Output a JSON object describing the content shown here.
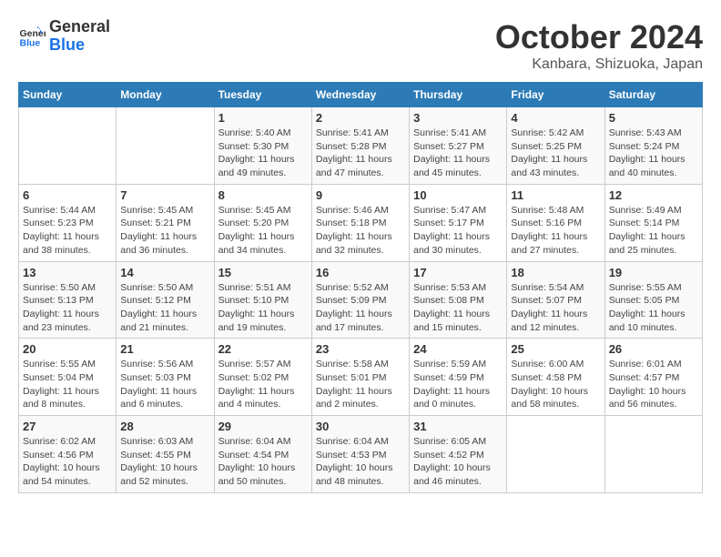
{
  "header": {
    "logo": {
      "line1": "General",
      "line2": "Blue"
    },
    "title": "October 2024",
    "location": "Kanbara, Shizuoka, Japan"
  },
  "days_of_week": [
    "Sunday",
    "Monday",
    "Tuesday",
    "Wednesday",
    "Thursday",
    "Friday",
    "Saturday"
  ],
  "weeks": [
    [
      {
        "day": null,
        "data": null
      },
      {
        "day": null,
        "data": null
      },
      {
        "day": "1",
        "data": "Sunrise: 5:40 AM\nSunset: 5:30 PM\nDaylight: 11 hours and 49 minutes."
      },
      {
        "day": "2",
        "data": "Sunrise: 5:41 AM\nSunset: 5:28 PM\nDaylight: 11 hours and 47 minutes."
      },
      {
        "day": "3",
        "data": "Sunrise: 5:41 AM\nSunset: 5:27 PM\nDaylight: 11 hours and 45 minutes."
      },
      {
        "day": "4",
        "data": "Sunrise: 5:42 AM\nSunset: 5:25 PM\nDaylight: 11 hours and 43 minutes."
      },
      {
        "day": "5",
        "data": "Sunrise: 5:43 AM\nSunset: 5:24 PM\nDaylight: 11 hours and 40 minutes."
      }
    ],
    [
      {
        "day": "6",
        "data": "Sunrise: 5:44 AM\nSunset: 5:23 PM\nDaylight: 11 hours and 38 minutes."
      },
      {
        "day": "7",
        "data": "Sunrise: 5:45 AM\nSunset: 5:21 PM\nDaylight: 11 hours and 36 minutes."
      },
      {
        "day": "8",
        "data": "Sunrise: 5:45 AM\nSunset: 5:20 PM\nDaylight: 11 hours and 34 minutes."
      },
      {
        "day": "9",
        "data": "Sunrise: 5:46 AM\nSunset: 5:18 PM\nDaylight: 11 hours and 32 minutes."
      },
      {
        "day": "10",
        "data": "Sunrise: 5:47 AM\nSunset: 5:17 PM\nDaylight: 11 hours and 30 minutes."
      },
      {
        "day": "11",
        "data": "Sunrise: 5:48 AM\nSunset: 5:16 PM\nDaylight: 11 hours and 27 minutes."
      },
      {
        "day": "12",
        "data": "Sunrise: 5:49 AM\nSunset: 5:14 PM\nDaylight: 11 hours and 25 minutes."
      }
    ],
    [
      {
        "day": "13",
        "data": "Sunrise: 5:50 AM\nSunset: 5:13 PM\nDaylight: 11 hours and 23 minutes."
      },
      {
        "day": "14",
        "data": "Sunrise: 5:50 AM\nSunset: 5:12 PM\nDaylight: 11 hours and 21 minutes."
      },
      {
        "day": "15",
        "data": "Sunrise: 5:51 AM\nSunset: 5:10 PM\nDaylight: 11 hours and 19 minutes."
      },
      {
        "day": "16",
        "data": "Sunrise: 5:52 AM\nSunset: 5:09 PM\nDaylight: 11 hours and 17 minutes."
      },
      {
        "day": "17",
        "data": "Sunrise: 5:53 AM\nSunset: 5:08 PM\nDaylight: 11 hours and 15 minutes."
      },
      {
        "day": "18",
        "data": "Sunrise: 5:54 AM\nSunset: 5:07 PM\nDaylight: 11 hours and 12 minutes."
      },
      {
        "day": "19",
        "data": "Sunrise: 5:55 AM\nSunset: 5:05 PM\nDaylight: 11 hours and 10 minutes."
      }
    ],
    [
      {
        "day": "20",
        "data": "Sunrise: 5:55 AM\nSunset: 5:04 PM\nDaylight: 11 hours and 8 minutes."
      },
      {
        "day": "21",
        "data": "Sunrise: 5:56 AM\nSunset: 5:03 PM\nDaylight: 11 hours and 6 minutes."
      },
      {
        "day": "22",
        "data": "Sunrise: 5:57 AM\nSunset: 5:02 PM\nDaylight: 11 hours and 4 minutes."
      },
      {
        "day": "23",
        "data": "Sunrise: 5:58 AM\nSunset: 5:01 PM\nDaylight: 11 hours and 2 minutes."
      },
      {
        "day": "24",
        "data": "Sunrise: 5:59 AM\nSunset: 4:59 PM\nDaylight: 11 hours and 0 minutes."
      },
      {
        "day": "25",
        "data": "Sunrise: 6:00 AM\nSunset: 4:58 PM\nDaylight: 10 hours and 58 minutes."
      },
      {
        "day": "26",
        "data": "Sunrise: 6:01 AM\nSunset: 4:57 PM\nDaylight: 10 hours and 56 minutes."
      }
    ],
    [
      {
        "day": "27",
        "data": "Sunrise: 6:02 AM\nSunset: 4:56 PM\nDaylight: 10 hours and 54 minutes."
      },
      {
        "day": "28",
        "data": "Sunrise: 6:03 AM\nSunset: 4:55 PM\nDaylight: 10 hours and 52 minutes."
      },
      {
        "day": "29",
        "data": "Sunrise: 6:04 AM\nSunset: 4:54 PM\nDaylight: 10 hours and 50 minutes."
      },
      {
        "day": "30",
        "data": "Sunrise: 6:04 AM\nSunset: 4:53 PM\nDaylight: 10 hours and 48 minutes."
      },
      {
        "day": "31",
        "data": "Sunrise: 6:05 AM\nSunset: 4:52 PM\nDaylight: 10 hours and 46 minutes."
      },
      {
        "day": null,
        "data": null
      },
      {
        "day": null,
        "data": null
      }
    ]
  ]
}
